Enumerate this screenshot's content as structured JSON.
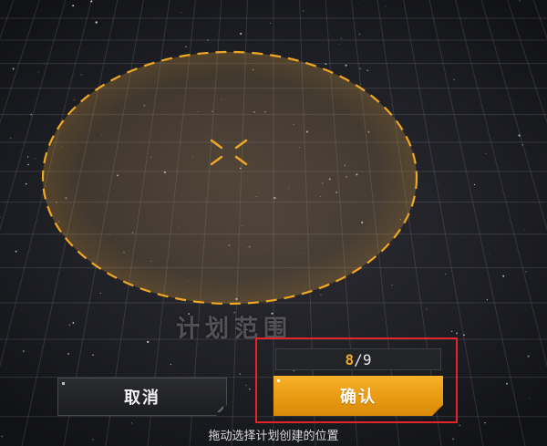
{
  "map": {
    "plan_range_label": "计划范围",
    "range_color": "#f0a724"
  },
  "counter": {
    "current": "8",
    "separator": "/",
    "max": "9",
    "accent": "#f0a724"
  },
  "buttons": {
    "cancel_label": "取消",
    "confirm_label": "确认"
  },
  "hint": "拖动选择计划创建的位置",
  "highlight": {
    "color": "#e3242b"
  },
  "icons": [
    "crosshair-icon",
    "button-corner-dot-icon",
    "button-corner-triangle-icon"
  ]
}
